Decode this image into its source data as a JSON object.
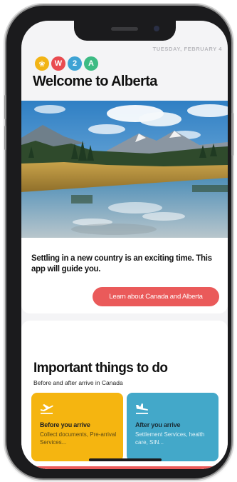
{
  "status": {
    "date": "TUESDAY, FEBRUARY 4"
  },
  "brand": {
    "logos": [
      {
        "glyph": "❀",
        "color": "#f2b416",
        "icon": "flower-icon"
      },
      {
        "glyph": "W",
        "color": "#e94b50"
      },
      {
        "glyph": "2",
        "color": "#3ea3d4"
      },
      {
        "glyph": "A",
        "color": "#3dbb84"
      }
    ]
  },
  "header": {
    "title": "Welcome to Alberta"
  },
  "hero": {
    "image_icon": "mountain-lake-landscape",
    "intro_text": "Settling in a new country is an exciting time. This app will guide you.",
    "cta_label": "Learn about Canada and Alberta"
  },
  "todo": {
    "title": "Important things to do",
    "subtitle": "Before and after arrive in Canada",
    "cards": [
      {
        "title": "Before you arrive",
        "desc": "Collect documents, Pre-arrival Services...",
        "icon": "plane-departure-icon",
        "color": "#f5b510"
      },
      {
        "title": "After you arrive",
        "desc": "Settlement Services, health care, SIN...",
        "icon": "plane-arrival-icon",
        "color": "#43a8c9"
      }
    ]
  },
  "colors": {
    "accent": "#ea5a5a",
    "background": "#f4f4f6"
  }
}
